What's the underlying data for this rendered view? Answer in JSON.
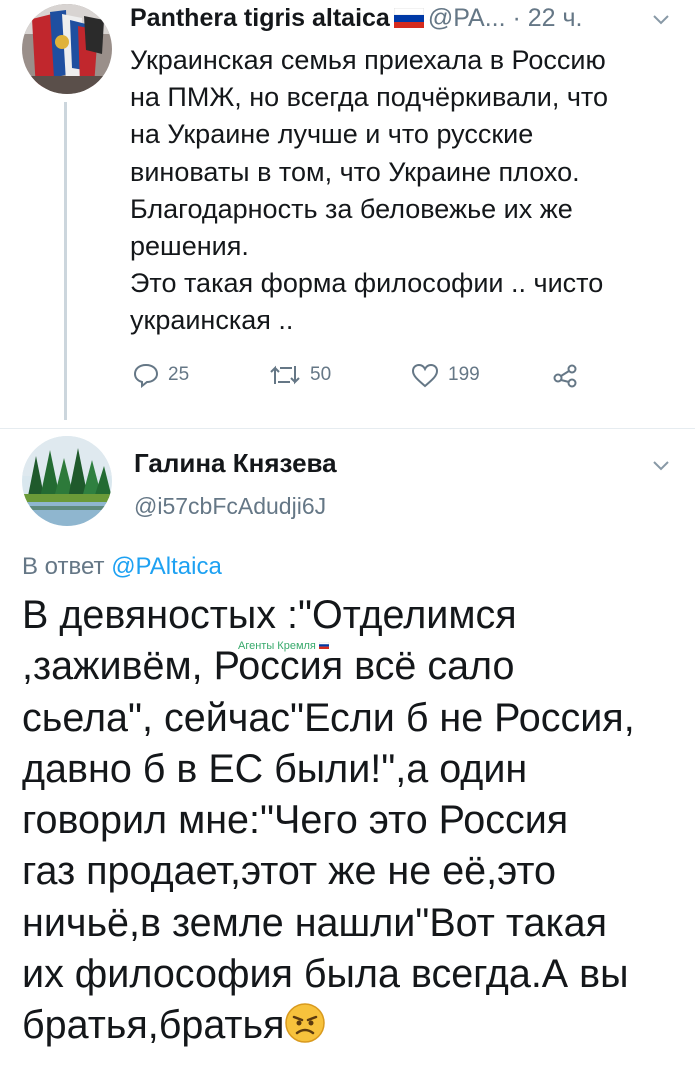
{
  "tweet": {
    "author_name": "Panthera tigris altaica",
    "author_handle": "@PA...",
    "separator": "·",
    "time": "22 ч.",
    "flag": "russian-flag",
    "avatar": "flags-collage-avatar",
    "body_lines": [
      "Украинская семья приехала в Россию",
      "на ПМЖ, но всегда подчёркивали, что",
      "на Украине лучше и что русские",
      "виноваты в том, что Украине плохо.",
      "Благодарность за беловежье их же",
      "решения.",
      "Это такая форма философии .. чисто",
      "украинская .."
    ],
    "actions": {
      "replies": "25",
      "retweets": "50",
      "likes": "199"
    }
  },
  "reply": {
    "author_name": "Галина Князева",
    "author_handle": "@i57cbFcAdudji6J",
    "avatar": "forest-lake-avatar",
    "reply_prefix": "В ответ",
    "reply_to": "@PAltaica",
    "body_lines": [
      "В девяностых :\"Отделимся",
      ",заживём, Россия всё сало",
      "сьела\", сейчас\"Если б не Россия,",
      "давно б в ЕС были!\",а один",
      "говорил мне:\"Чего это Россия",
      "газ продает,этот же не её,это",
      "ничьё,в земле нашли\"Вот такая",
      "их философия была всегда.А вы",
      "братья,братья"
    ],
    "emoji": "angry-face-emoji"
  },
  "watermark": {
    "text": "Агенты Кремля"
  },
  "colors": {
    "text": "#14171a",
    "secondary": "#657786",
    "link": "#1da1f2",
    "watermark": "#37a96b",
    "thread_line": "#ccd6dd"
  }
}
